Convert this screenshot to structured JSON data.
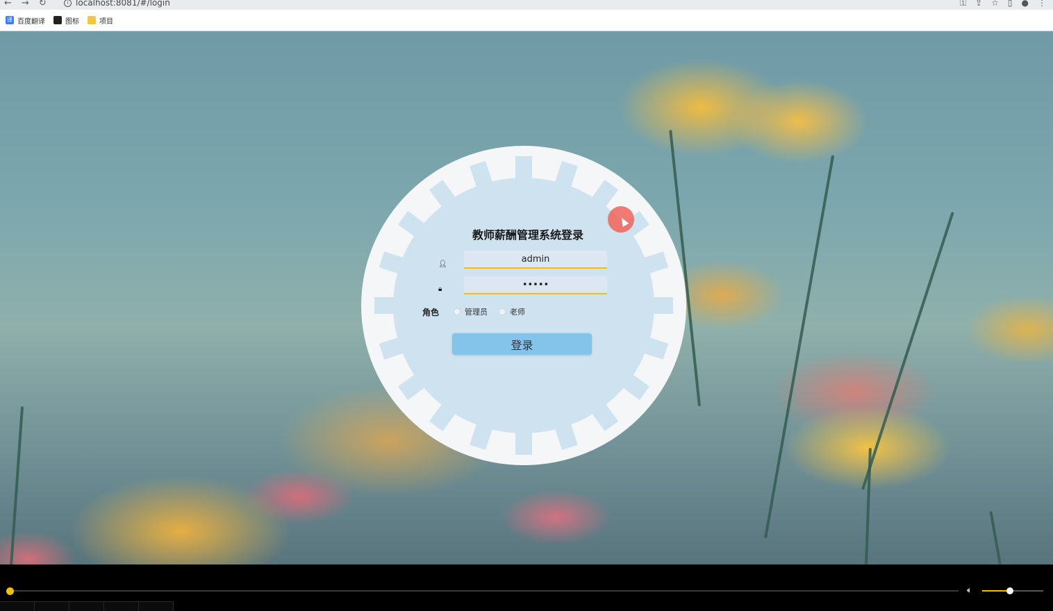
{
  "browser": {
    "url": "localhost:8081/#/login",
    "bookmarks": [
      {
        "label": "百度翻译",
        "color": "#3a7ef5",
        "glyph": "译"
      },
      {
        "label": "图标",
        "color": "#222222",
        "glyph": "▣"
      },
      {
        "label": "项目",
        "color": "#f5c542",
        "glyph": ""
      }
    ]
  },
  "login": {
    "title": "教师薪酬管理系统登录",
    "username_value": "admin",
    "password_value": "•••••",
    "role_label": "角色",
    "roles": [
      "管理员",
      "老师"
    ],
    "submit_label": "登录"
  },
  "player": {
    "progress": 0.0,
    "volume": 0.45,
    "accent": "#f2c200"
  }
}
